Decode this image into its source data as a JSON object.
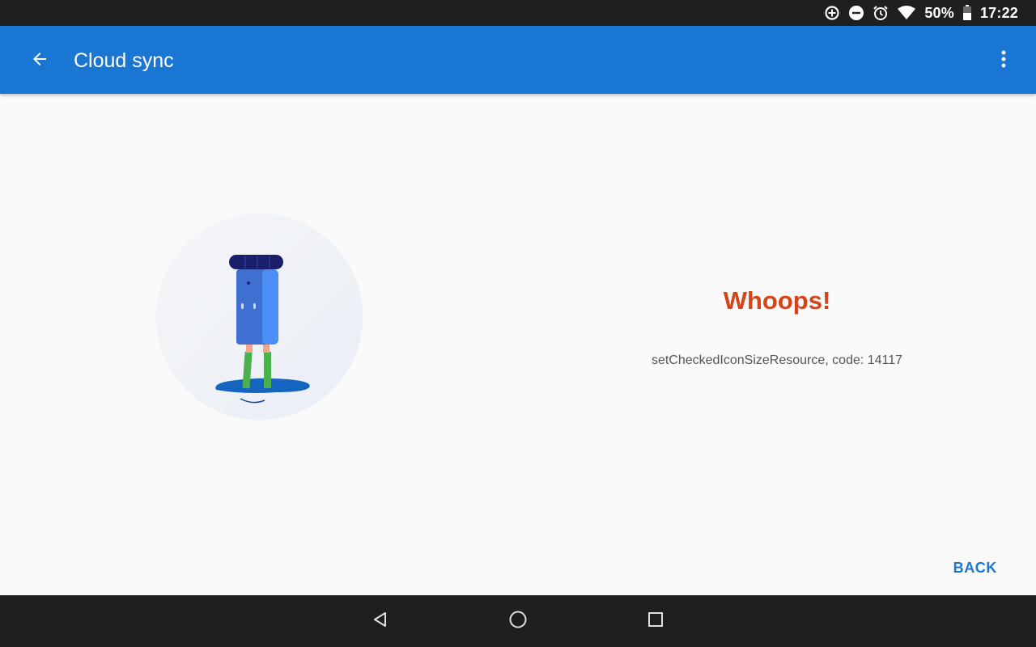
{
  "status_bar": {
    "battery_percent": "50%",
    "time": "17:22",
    "icons": [
      "data-saver-icon",
      "do-not-disturb-icon",
      "alarm-icon",
      "wifi-icon",
      "battery-icon"
    ]
  },
  "app_bar": {
    "title": "Cloud sync",
    "back_icon": "arrow-back-icon",
    "overflow_icon": "more-vert-icon",
    "color": "#1976d2"
  },
  "error": {
    "title": "Whoops!",
    "message": "setCheckedIconSizeResource, code: 14117",
    "title_color": "#d84315"
  },
  "actions": {
    "back_label": "BACK"
  },
  "nav_bar": {
    "icons": [
      "nav-back-icon",
      "nav-home-icon",
      "nav-recents-icon"
    ]
  }
}
